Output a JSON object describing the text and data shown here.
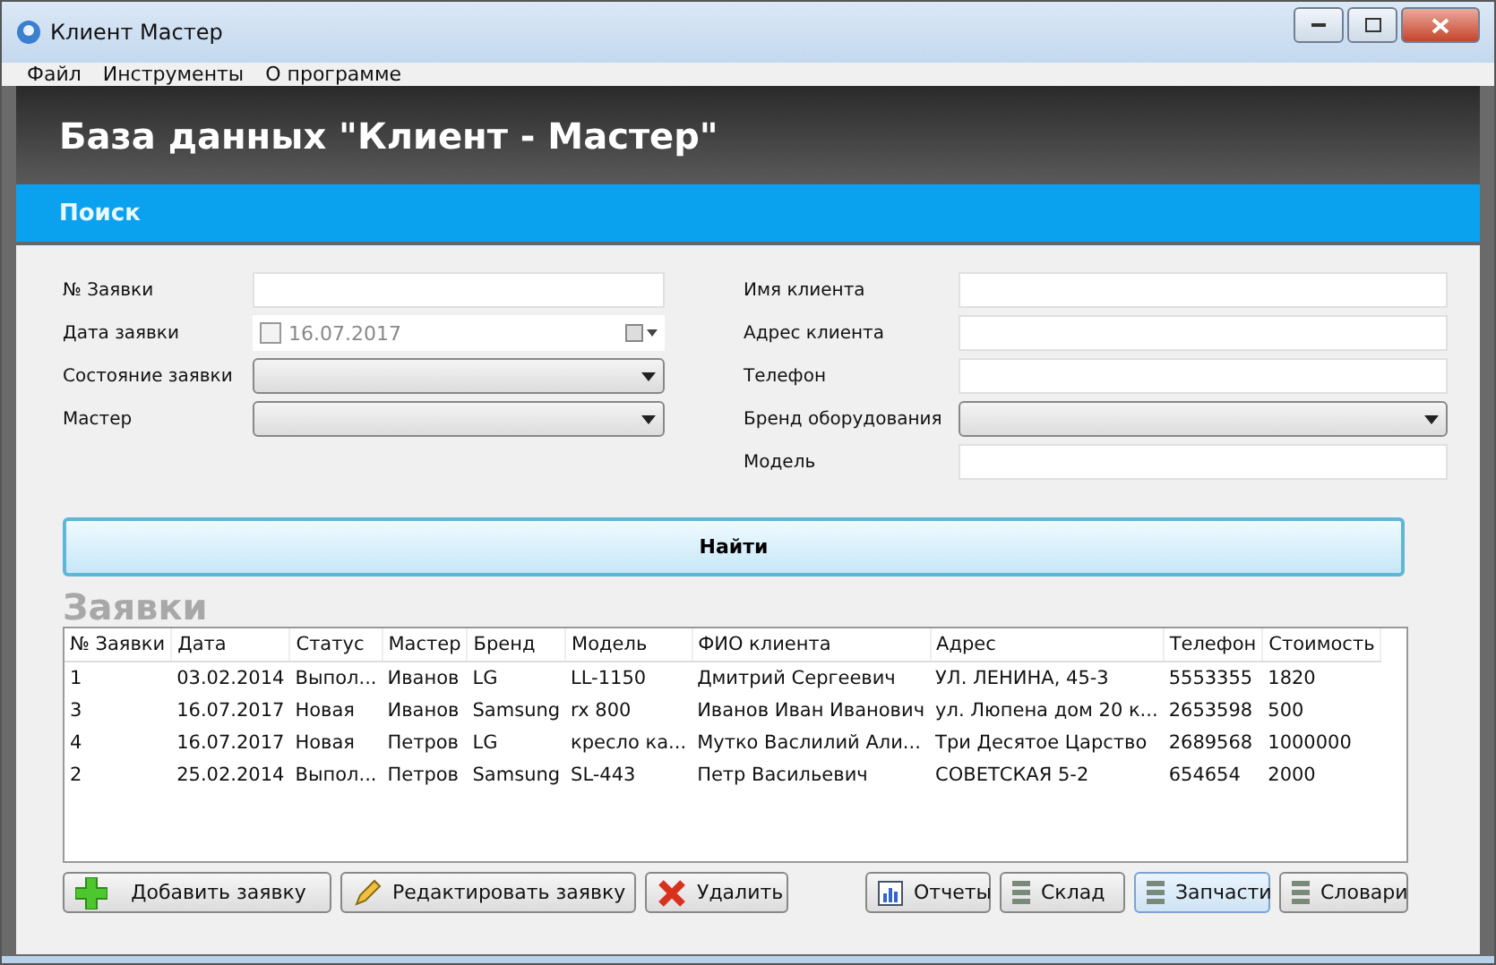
{
  "window": {
    "title": "Клиент Мастер"
  },
  "menu": [
    "Файл",
    "Инструменты",
    "О программе"
  ],
  "header": {
    "title": "База данных \"Клиент - Мастер\""
  },
  "search_bar": {
    "title": "Поиск"
  },
  "search_left": [
    {
      "label": "№ Заявки",
      "kind": "text"
    },
    {
      "label": "Дата заявки",
      "kind": "date",
      "value": "16.07.2017",
      "checked": false
    },
    {
      "label": "Состояние заявки",
      "kind": "select"
    },
    {
      "label": "Мастер",
      "kind": "select"
    }
  ],
  "search_right": [
    {
      "label": "Имя клиента",
      "kind": "text"
    },
    {
      "label": "Адрес клиента",
      "kind": "text"
    },
    {
      "label": "Телефон",
      "kind": "text"
    },
    {
      "label": "Бренд оборудования",
      "kind": "select"
    },
    {
      "label": "Модель",
      "kind": "text"
    }
  ],
  "find_button": "Найти",
  "orders": {
    "title": "Заявки",
    "columns": [
      "№ Заявки",
      "Дата",
      "Статус",
      "Мастер",
      "Бренд",
      "Модель",
      "ФИО клиента",
      "Адрес",
      "Телефон",
      "Стоимость"
    ],
    "rows": [
      [
        "1",
        "03.02.2014",
        "Выпол...",
        "Иванов",
        "LG",
        "LL-1150",
        "Дмитрий Сергеевич",
        "УЛ. ЛЕНИНА, 45-3",
        "5553355",
        "1820"
      ],
      [
        "3",
        "16.07.2017",
        "Новая",
        "Иванов",
        "Samsung",
        "rx 800",
        "Иванов Иван Иванович",
        "ул. Люпена дом 20 к...",
        "2653598",
        "500"
      ],
      [
        "4",
        "16.07.2017",
        "Новая",
        "Петров",
        "LG",
        "кресло ка...",
        "Мутко Васлилий Али...",
        "Три Десятое Царство",
        "2689568",
        "1000000"
      ],
      [
        "2",
        "25.02.2014",
        "Выпол...",
        "Петров",
        "Samsung",
        "SL-443",
        "Петр Васильевич",
        "СОВЕТСКАЯ 5-2",
        "654654",
        "2000"
      ]
    ]
  },
  "buttons_left": [
    {
      "label": "Добавить заявку",
      "kind": "add"
    },
    {
      "label": "Редактировать заявку",
      "kind": "edit"
    },
    {
      "label": "Удалить",
      "kind": "delete"
    }
  ],
  "buttons_right": [
    {
      "label": "Отчеты",
      "kind": "chart",
      "selected": false
    },
    {
      "label": "Склад",
      "kind": "stack",
      "selected": false
    },
    {
      "label": "Запчасти",
      "kind": "stack",
      "selected": true
    },
    {
      "label": "Словари",
      "kind": "stack",
      "selected": false
    }
  ]
}
